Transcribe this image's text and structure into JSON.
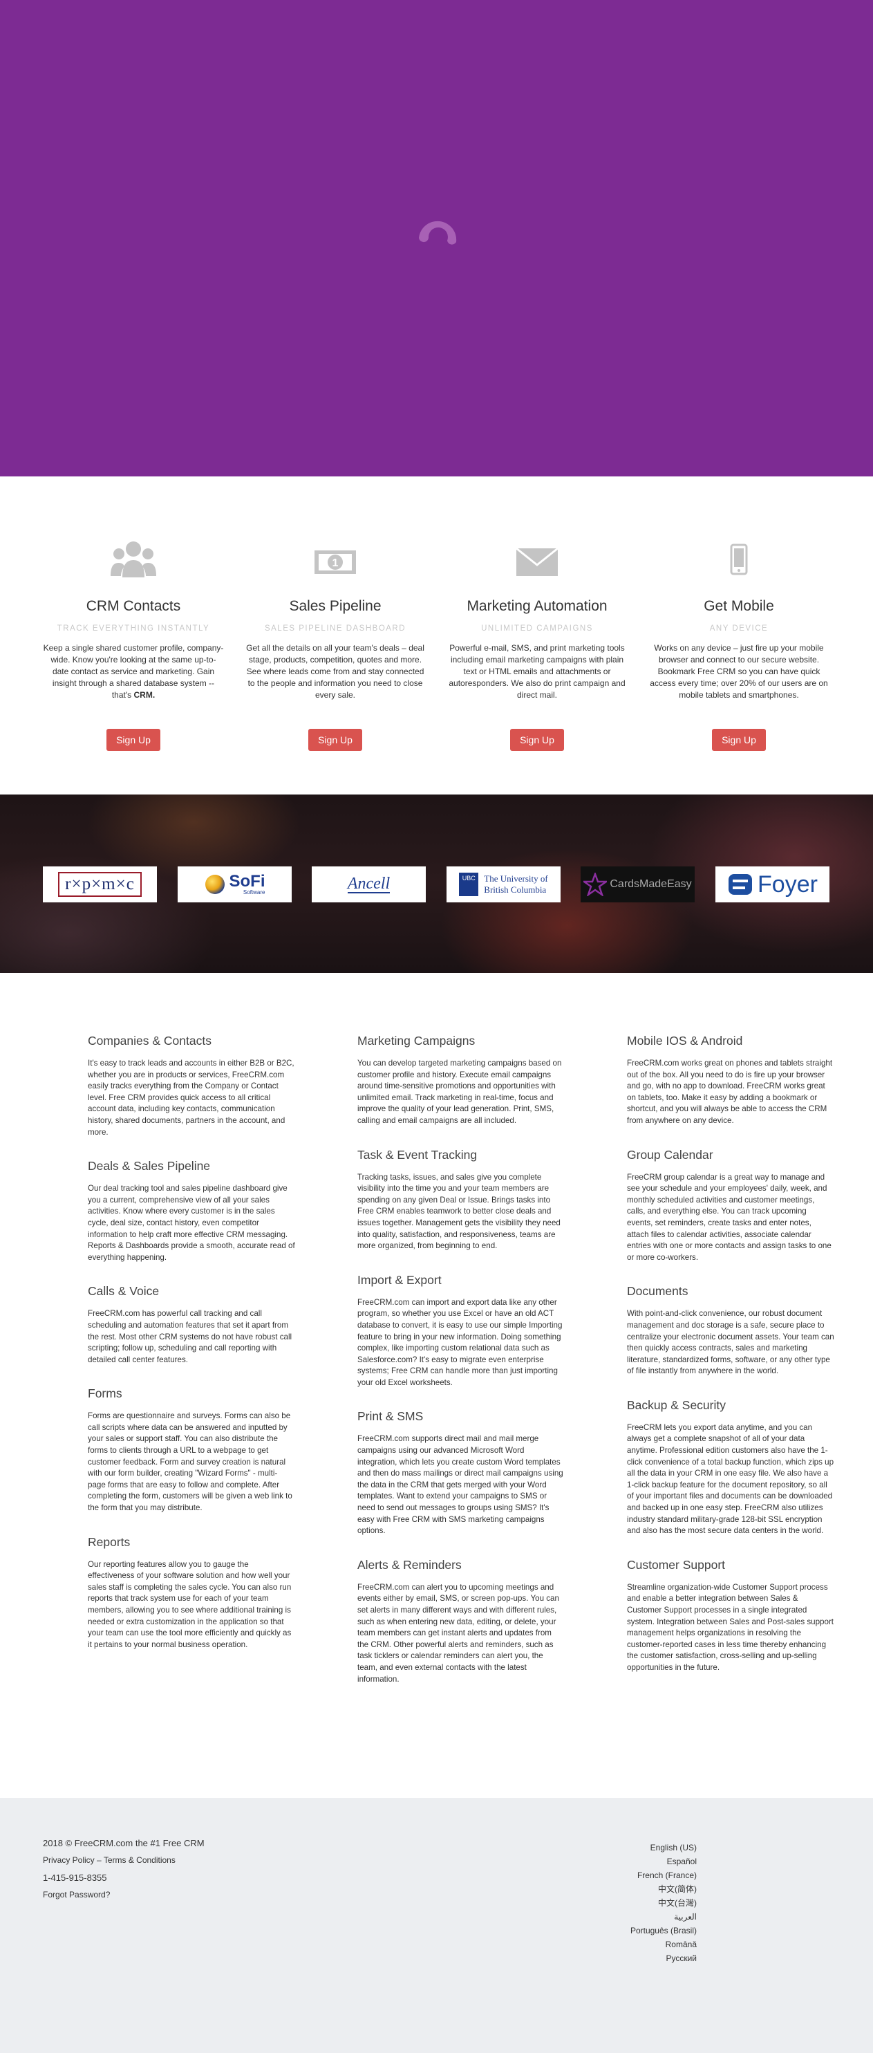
{
  "hero": {
    "color": "#7d2b93"
  },
  "features": [
    {
      "icon": "users-icon",
      "title": "CRM Contacts",
      "subtitle": "TRACK EVERYTHING INSTANTLY",
      "text": "Keep a single shared customer profile, company-wide. Know you're looking at the same up-to-date contact as service and marketing. Gain insight through a shared database system -- that's ",
      "strong": "CRM.",
      "button": "Sign Up"
    },
    {
      "icon": "money-icon",
      "title": "Sales Pipeline",
      "subtitle": "SALES PIPELINE DASHBOARD",
      "text": "Get all the details on all your team's deals – deal stage, products, competition, quotes and more. See where leads come from and stay connected to the people and information you need to close every sale.",
      "strong": "",
      "button": "Sign Up"
    },
    {
      "icon": "envelope-icon",
      "title": "Marketing Automation",
      "subtitle": "UNLIMITED CAMPAIGNS",
      "text": "Powerful e-mail, SMS, and print marketing tools including email marketing campaigns with plain text or HTML emails and attachments or autoresponders. We also do print campaign and direct mail.",
      "strong": "",
      "button": "Sign Up"
    },
    {
      "icon": "mobile-icon",
      "title": "Get Mobile",
      "subtitle": "ANY DEVICE",
      "text": "Works on any device – just fire up your mobile browser and connect to our secure website. Bookmark Free CRM so you can have quick access every time; over 20% of our users are on mobile tablets and smartphones.",
      "strong": "",
      "button": "Sign Up"
    }
  ],
  "logos": {
    "rpmc": "r×p×m×c",
    "sofi": "SoFi",
    "sofi_sub": "Software",
    "ancell": "Ancell",
    "ubc_badge": "UBC",
    "ubc_line1": "The University of",
    "ubc_line2": "British Columbia",
    "cardsmadeeasy": "CardsMadeEasy",
    "foyer": "Foyer"
  },
  "info_columns": [
    [
      {
        "title": "Companies & Contacts",
        "text": "It's easy to track leads and accounts in either B2B or B2C, whether you are in products or services, FreeCRM.com easily tracks everything from the Company or Contact level. Free CRM provides quick access to all critical account data, including key contacts, communication history, shared documents, partners in the account, and more."
      },
      {
        "title": "Deals & Sales Pipeline",
        "text": "Our deal tracking tool and sales pipeline dashboard give you a current, comprehensive view of all your sales activities. Know where every customer is in the sales cycle, deal size, contact history, even competitor information to help craft more effective CRM messaging. Reports & Dashboards provide a smooth, accurate read of everything happening."
      },
      {
        "title": "Calls & Voice",
        "text": "FreeCRM.com has powerful call tracking and call scheduling and automation features that set it apart from the rest. Most other CRM systems do not have robust call scripting; follow up, scheduling and call reporting with detailed call center features."
      },
      {
        "title": "Forms",
        "text": "Forms are questionnaire and surveys. Forms can also be call scripts where data can be answered and inputted by your sales or support staff. You can also distribute the forms to clients through a URL to a webpage to get customer feedback. Form and survey creation is natural with our form builder, creating \"Wizard Forms\" - multi-page forms that are easy to follow and complete. After completing the form, customers will be given a web link to the form that you may distribute."
      },
      {
        "title": "Reports",
        "text": "Our reporting features allow you to gauge the effectiveness of your software solution and how well your sales staff is completing the sales cycle. You can also run reports that track system use for each of your team members, allowing you to see where additional training is needed or extra customization in the application so that your team can use the tool more efficiently and quickly as it pertains to your normal business operation."
      }
    ],
    [
      {
        "title": "Marketing Campaigns",
        "text": "You can develop targeted marketing campaigns based on customer profile and history. Execute email campaigns around time-sensitive promotions and opportunities with unlimited email. Track marketing in real-time, focus and improve the quality of your lead generation. Print, SMS, calling and email campaigns are all included."
      },
      {
        "title": "Task & Event Tracking",
        "text": "Tracking tasks, issues, and sales give you complete visibility into the time you and your team members are spending on any given Deal or Issue. Brings tasks into Free CRM enables teamwork to better close deals and issues together. Management gets the visibility they need into quality, satisfaction, and responsiveness, teams are more organized, from beginning to end."
      },
      {
        "title": "Import & Export",
        "text": "FreeCRM.com can import and export data like any other program, so whether you use Excel or have an old ACT database to convert, it is easy to use our simple Importing feature to bring in your new information. Doing something complex, like importing custom relational data such as Salesforce.com? It's easy to migrate even enterprise systems; Free CRM can handle more than just importing your old Excel worksheets."
      },
      {
        "title": "Print & SMS",
        "text": "FreeCRM.com supports direct mail and mail merge campaigns using our advanced Microsoft Word integration, which lets you create custom Word templates and then do mass mailings or direct mail campaigns using the data in the CRM that gets merged with your Word templates. Want to extend your campaigns to SMS or need to send out messages to groups using SMS? It's easy with Free CRM with SMS marketing campaigns options."
      },
      {
        "title": "Alerts & Reminders",
        "text": "FreeCRM.com can alert you to upcoming meetings and events either by email, SMS, or screen pop-ups. You can set alerts in many different ways and with different rules, such as when entering new data, editing, or delete, your team members can get instant alerts and updates from the CRM. Other powerful alerts and reminders, such as task ticklers or calendar reminders can alert you, the team, and even external contacts with the latest information."
      }
    ],
    [
      {
        "title": "Mobile IOS & Android",
        "text": "FreeCRM.com works great on phones and tablets straight out of the box. All you need to do is fire up your browser and go, with no app to download. FreeCRM works great on tablets, too. Make it easy by adding a bookmark or shortcut, and you will always be able to access the CRM from anywhere on any device."
      },
      {
        "title": "Group Calendar",
        "text": "FreeCRM group calendar is a great way to manage and see your schedule and your employees' daily, week, and monthly scheduled activities and customer meetings, calls, and everything else. You can track upcoming events, set reminders, create tasks and enter notes, attach files to calendar activities, associate calendar entries with one or more contacts and assign tasks to one or more co-workers."
      },
      {
        "title": "Documents",
        "text": "With point-and-click convenience, our robust document management and doc storage is a safe, secure place to centralize your electronic document assets. Your team can then quickly access contracts, sales and marketing literature, standardized forms, software, or any other type of file instantly from anywhere in the world."
      },
      {
        "title": "Backup & Security",
        "text": "FreeCRM lets you export data anytime, and you can always get a complete snapshot of all of your data anytime. Professional edition customers also have the 1-click convenience of a total backup function, which zips up all the data in your CRM in one easy file. We also have a 1-click backup feature for the document repository, so all of your important files and documents can be downloaded and backed up in one easy step. FreeCRM also utilizes industry standard military-grade 128-bit SSL encryption and also has the most secure data centers in the world."
      },
      {
        "title": "Customer Support",
        "text": "Streamline organization-wide Customer Support process and enable a better integration between Sales & Customer Support processes in a single integrated system. Integration between Sales and Post-sales support management helps organizations in resolving the customer-reported cases in less time thereby enhancing the customer satisfaction, cross-selling and up-selling opportunities in the future."
      }
    ]
  ],
  "footer": {
    "copyright": "2018 © FreeCRM.com the #1 Free CRM",
    "privacy": "Privacy Policy",
    "separator": " – ",
    "terms": "Terms & Conditions",
    "phone": "1-415-915-8355",
    "forgot": "Forgot Password?",
    "languages": [
      "English (US)",
      "Español",
      "French (France)",
      "中文(简体)",
      "中文(台灣)",
      "العربية",
      "Português (Brasil)",
      "Română",
      "Русский"
    ]
  }
}
